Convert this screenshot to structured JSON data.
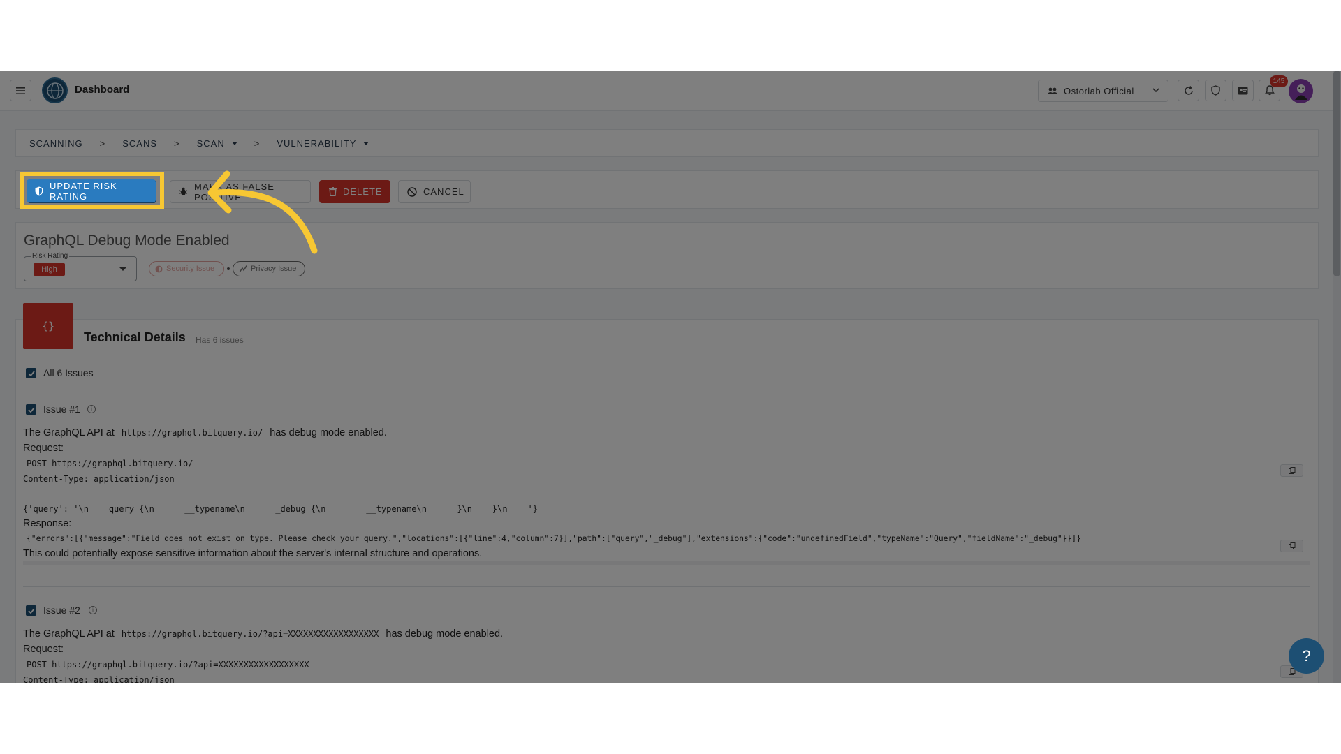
{
  "topbar": {
    "title": "Dashboard",
    "org": "Ostorlab Official",
    "notification_count": "145"
  },
  "breadcrumb": [
    "SCANNING",
    "SCANS",
    "SCAN",
    "VULNERABILITY"
  ],
  "breadcrumb_sep": ">",
  "actions": {
    "update_risk": "UPDATE RISK RATING",
    "false_positive": "MARK AS FALSE POSITIVE",
    "delete": "DELETE",
    "cancel": "CANCEL"
  },
  "vulnerability": {
    "title": "GraphQL Debug Mode Enabled",
    "risk_label": "Risk Rating",
    "risk_value": "High",
    "tag_security": "Security Issue",
    "tag_privacy": "Privacy Issue"
  },
  "technical": {
    "icon_text": "{}",
    "title": "Technical Details",
    "subtitle": "Has 6 issues",
    "all_label": "All 6 Issues",
    "issues": [
      {
        "label": "Issue #1",
        "intro_a": "The GraphQL API at",
        "url": "https://graphql.bitquery.io/",
        "intro_b": "has debug mode enabled.",
        "request_label": "Request:",
        "request_line": "POST https://graphql.bitquery.io/",
        "content_type": "Content-Type: application/json",
        "body": "{'query': '\\n    query {\\n      __typename\\n      _debug {\\n        __typename\\n      }\\n    }\\n    '}",
        "response_label": "Response:",
        "response": "{\"errors\":[{\"message\":\"Field does not exist on type. Please check your query.\",\"locations\":[{\"line\":4,\"column\":7}],\"path\":[\"query\",\"_debug\"],\"extensions\":{\"code\":\"undefinedField\",\"typeName\":\"Query\",\"fieldName\":\"_debug\"}}]}",
        "conclusion": "This could potentially expose sensitive information about the server's internal structure and operations."
      },
      {
        "label": "Issue #2",
        "intro_a": "The GraphQL API at",
        "url": "https://graphql.bitquery.io/?api=XXXXXXXXXXXXXXXXXX",
        "intro_b": "has debug mode enabled.",
        "request_label": "Request:",
        "request_line": "POST https://graphql.bitquery.io/?api=XXXXXXXXXXXXXXXXXX",
        "content_type": "Content-Type: application/json"
      }
    ]
  },
  "help": "?",
  "colors": {
    "primary": "#2a7bbf",
    "danger": "#d9342b",
    "navy": "#1d4f73",
    "highlight": "#f7c733"
  }
}
